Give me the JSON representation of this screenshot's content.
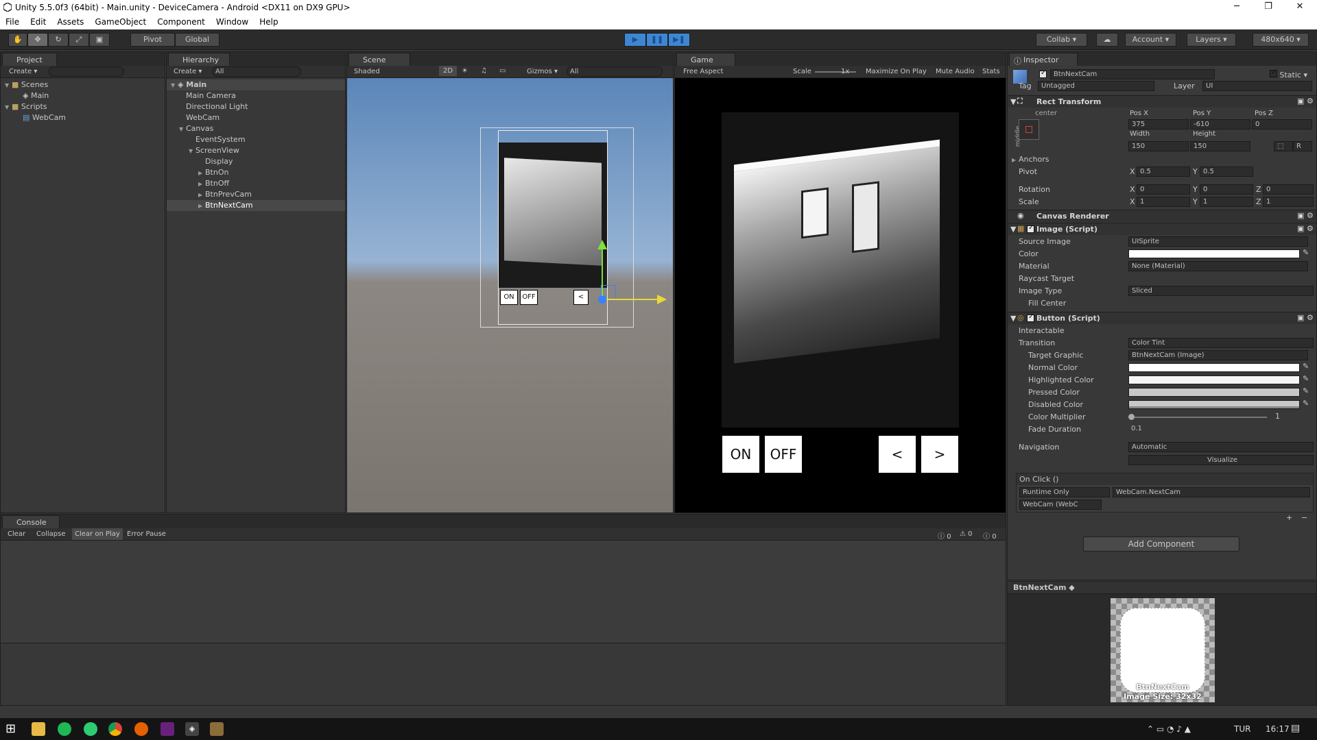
{
  "window": {
    "title": "Unity 5.5.0f3 (64bit) - Main.unity - DeviceCamera - Android <DX11 on DX9 GPU>",
    "minimize": "─",
    "maximize": "❐",
    "close": "✕"
  },
  "menu": [
    "File",
    "Edit",
    "Assets",
    "GameObject",
    "Component",
    "Window",
    "Help"
  ],
  "toolbar": {
    "pivot": "Pivot",
    "global": "Global",
    "collab": "Collab",
    "account": "Account",
    "layers": "Layers",
    "layout": "480x640"
  },
  "project": {
    "tab": "Project",
    "create": "Create",
    "items": [
      {
        "label": "Scenes"
      },
      {
        "label": "Main"
      },
      {
        "label": "Scripts"
      },
      {
        "label": "WebCam"
      }
    ]
  },
  "hierarchy": {
    "tab": "Hierarchy",
    "create": "Create",
    "search": "All",
    "scene": "Main",
    "items": [
      "Main Camera",
      "Directional Light",
      "WebCam",
      "Canvas",
      "EventSystem",
      "ScreenView",
      "Display",
      "BtnOn",
      "BtnOff",
      "BtnPrevCam",
      "BtnNextCam"
    ]
  },
  "scene": {
    "tab": "Scene",
    "shaded": "Shaded",
    "mode2d": "2D",
    "gizmos": "Gizmos",
    "search": "All",
    "btn_on": "ON",
    "btn_off": "OFF",
    "btn_prev": "<"
  },
  "game": {
    "tab": "Game",
    "aspect": "Free Aspect",
    "scale_label": "Scale",
    "scale_value": "1x",
    "maximize": "Maximize On Play",
    "mute": "Mute Audio",
    "stats": "Stats",
    "btn_on": "ON",
    "btn_off": "OFF",
    "btn_prev": "<",
    "btn_next": ">"
  },
  "console": {
    "tab": "Console",
    "clear": "Clear",
    "collapse": "Collapse",
    "clear_on_play": "Clear on Play",
    "error_pause": "Error Pause",
    "count_info": "0",
    "count_warn": "0",
    "count_err": "0"
  },
  "inspector": {
    "tab": "Inspector",
    "object_name": "BtnNextCam",
    "static_label": "Static",
    "tag_label": "Tag",
    "tag_value": "Untagged",
    "layer_label": "Layer",
    "layer_value": "UI",
    "rect": {
      "title": "Rect Transform",
      "anchor_preset": "center",
      "side": "middle",
      "posx_label": "Pos X",
      "posy_label": "Pos Y",
      "posz_label": "Pos Z",
      "posx": "375",
      "posy": "-610",
      "posz": "0",
      "width_label": "Width",
      "height_label": "Height",
      "width": "150",
      "height": "150",
      "anchors": "Anchors",
      "pivot": "Pivot",
      "pivot_x": "0.5",
      "pivot_y": "0.5",
      "rotation": "Rotation",
      "rot_x": "0",
      "rot_y": "0",
      "rot_z": "0",
      "scale": "Scale",
      "scale_x": "1",
      "scale_y": "1",
      "scale_z": "1"
    },
    "canvas_renderer": "Canvas Renderer",
    "image": {
      "title": "Image (Script)",
      "source_label": "Source Image",
      "source": "UISprite",
      "color_label": "Color",
      "material_label": "Material",
      "material": "None (Material)",
      "raycast_label": "Raycast Target",
      "type_label": "Image Type",
      "type": "Sliced",
      "fill_label": "Fill Center"
    },
    "button": {
      "title": "Button (Script)",
      "interactable": "Interactable",
      "transition_label": "Transition",
      "transition": "Color Tint",
      "target_label": "Target Graphic",
      "target": "BtnNextCam (Image)",
      "normal": "Normal Color",
      "highlighted": "Highlighted Color",
      "pressed": "Pressed Color",
      "disabled": "Disabled Color",
      "multiplier_label": "Color Multiplier",
      "multiplier": "1",
      "fade_label": "Fade Duration",
      "fade": "0.1",
      "navigation_label": "Navigation",
      "navigation": "Automatic",
      "visualize": "Visualize"
    },
    "onclick": {
      "title": "On Click ()",
      "runtime": "Runtime Only",
      "function": "WebCam.NextCam",
      "object": "WebCam (WebC"
    },
    "add_component": "Add Component"
  },
  "preview": {
    "title": "BtnNextCam",
    "name": "BtnNextCam",
    "size": "Image Size: 32x32"
  },
  "taskbar": {
    "lang": "TUR",
    "time": "16:17"
  },
  "colors": {
    "play_accent": "#3e86d3",
    "panel": "#383838",
    "dark": "#2b2b2b"
  }
}
